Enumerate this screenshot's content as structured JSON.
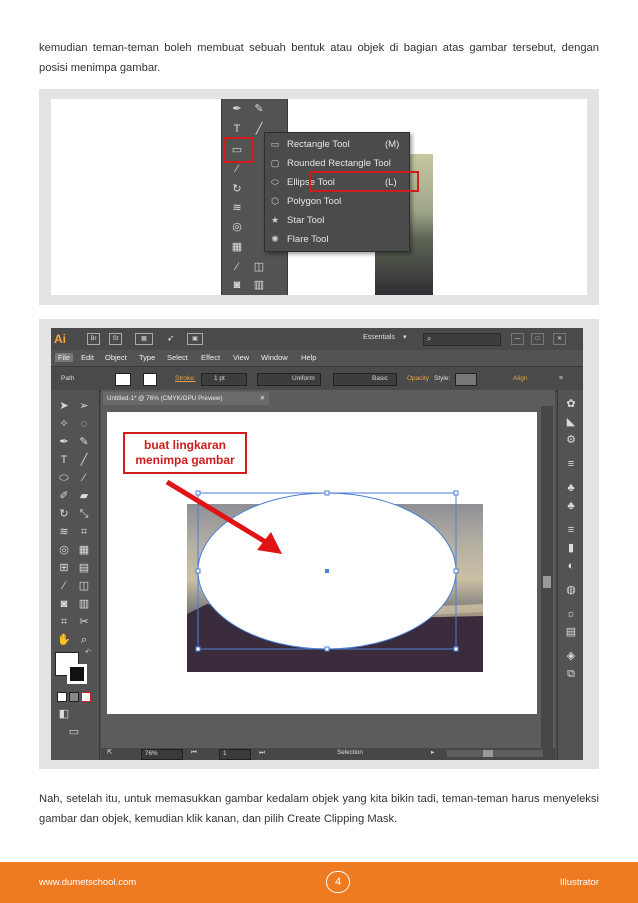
{
  "paragraph_top": "kemudian teman-teman boleh membuat sebuah bentuk atau objek di bagian atas gambar tersebut, dengan posisi menimpa gambar.",
  "paragraph_bottom": "Nah, setelah itu, untuk memasukkan gambar kedalam objek yang kita bikin tadi, teman-teman harus menyeleksi gambar dan objek, kemudian klik kanan, dan pilih Create Clipping Mask.",
  "flyout_menu": {
    "items": [
      {
        "label": "Rectangle Tool",
        "shortcut": "(M)",
        "icon": "rectangle-icon"
      },
      {
        "label": "Rounded Rectangle Tool",
        "shortcut": "",
        "icon": "rounded-rectangle-icon"
      },
      {
        "label": "Ellipse Tool",
        "shortcut": "(L)",
        "icon": "ellipse-icon"
      },
      {
        "label": "Polygon Tool",
        "shortcut": "",
        "icon": "polygon-icon"
      },
      {
        "label": "Star Tool",
        "shortcut": "",
        "icon": "star-icon"
      },
      {
        "label": "Flare Tool",
        "shortcut": "",
        "icon": "flare-icon"
      }
    ],
    "highlight_color": "#d01c1c"
  },
  "illustrator": {
    "app_logo": "Ai",
    "bridge_button": "Br",
    "stock_button": "St",
    "workspace": "Essentials",
    "menu": [
      "File",
      "Edit",
      "Object",
      "Type",
      "Select",
      "Effect",
      "View",
      "Window",
      "Help"
    ],
    "control": {
      "selection_label": "Path",
      "stroke_label": "Stroke:",
      "stroke_weight": "1 pt",
      "profile": "Uniform",
      "brush": "Basic",
      "opacity_label": "Opacity",
      "style_label": "Style:",
      "align_label": "Align"
    },
    "document_tab": "Untitled-1* @ 76% (CMYK/GPU Preview)",
    "callout_line1": "buat lingkaran",
    "callout_line2": "menimpa gambar",
    "status": {
      "zoom": "76%",
      "artboard": "1",
      "mode": "Selection"
    }
  },
  "footer": {
    "website": "www.dumetschool.com",
    "page_number": "4",
    "topic": "Illustrator"
  },
  "colors": {
    "accent_orange": "#ee7a22",
    "annotation_red": "#d01c1c",
    "ui_gray": "#535353"
  }
}
